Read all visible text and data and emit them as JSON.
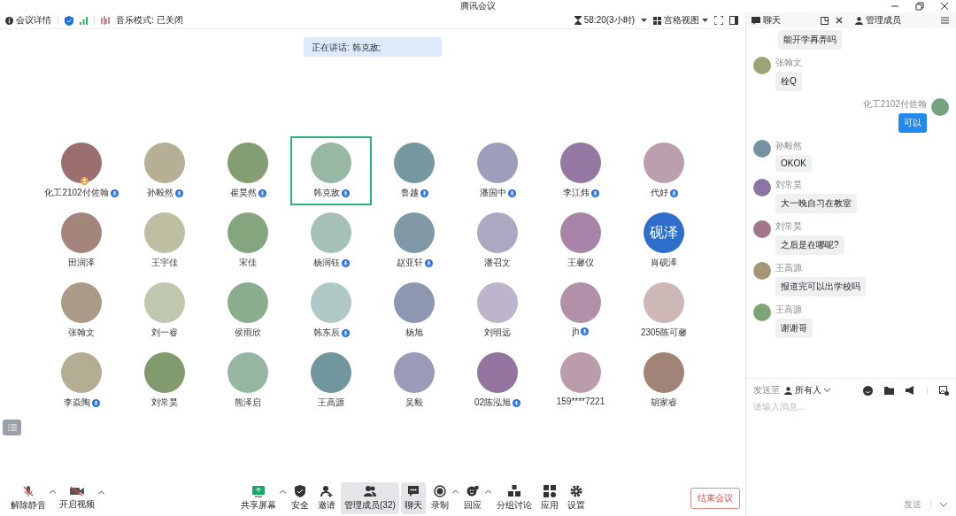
{
  "window": {
    "title": "腾讯会议"
  },
  "header": {
    "details": "会议详情",
    "music_mode": "音乐模式: 已关闭",
    "timer": "58:20(3小时)",
    "view": "宫格视图"
  },
  "speaking_banner": "正在讲话: 韩克敌;",
  "participants": [
    {
      "name": "化工2102付佐翰",
      "kind": "photo",
      "mic": true,
      "speaking": false,
      "host": true
    },
    {
      "name": "孙毅然",
      "kind": "photo",
      "mic": true,
      "speaking": false,
      "host": false
    },
    {
      "name": "崔昊然",
      "kind": "photo",
      "mic": true,
      "speaking": false,
      "host": false
    },
    {
      "name": "韩克敌",
      "kind": "photo",
      "mic": true,
      "speaking": true,
      "host": false
    },
    {
      "name": "鲁越",
      "kind": "photo",
      "mic": true,
      "speaking": false,
      "host": false
    },
    {
      "name": "潘国中",
      "kind": "photo",
      "mic": true,
      "speaking": false,
      "host": false
    },
    {
      "name": "李江炜",
      "kind": "photo",
      "mic": true,
      "speaking": false,
      "host": false
    },
    {
      "name": "代好",
      "kind": "photo",
      "mic": true,
      "speaking": false,
      "host": false
    },
    {
      "name": "田润泽",
      "kind": "photo",
      "mic": false,
      "speaking": false,
      "host": false
    },
    {
      "name": "王宇佳",
      "kind": "photo",
      "mic": false,
      "speaking": false,
      "host": false
    },
    {
      "name": "宋佳",
      "kind": "photo",
      "mic": false,
      "speaking": false,
      "host": false
    },
    {
      "name": "杨润钰",
      "kind": "photo",
      "mic": true,
      "speaking": false,
      "host": false
    },
    {
      "name": "赵亚轩",
      "kind": "photo",
      "mic": true,
      "speaking": false,
      "host": false
    },
    {
      "name": "潘召文",
      "kind": "photo",
      "mic": false,
      "speaking": false,
      "host": false
    },
    {
      "name": "王馨仪",
      "kind": "photo",
      "mic": false,
      "speaking": false,
      "host": false
    },
    {
      "name": "肖砚泽",
      "kind": "text",
      "initials": "砚泽",
      "mic": false,
      "speaking": false,
      "host": false
    },
    {
      "name": "张翰文",
      "kind": "photo",
      "mic": false,
      "speaking": false,
      "host": false
    },
    {
      "name": "刘一睿",
      "kind": "photo",
      "mic": false,
      "speaking": false,
      "host": false
    },
    {
      "name": "侯雨欣",
      "kind": "photo",
      "mic": false,
      "speaking": false,
      "host": false
    },
    {
      "name": "韩东辰",
      "kind": "photo",
      "mic": true,
      "speaking": false,
      "host": false
    },
    {
      "name": "杨旭",
      "kind": "photo",
      "mic": false,
      "speaking": false,
      "host": false
    },
    {
      "name": "刘明远",
      "kind": "photo",
      "mic": false,
      "speaking": false,
      "host": false
    },
    {
      "name": "jh",
      "kind": "photo",
      "mic": true,
      "speaking": false,
      "host": false
    },
    {
      "name": "2305陈可馨",
      "kind": "photo",
      "mic": false,
      "speaking": false,
      "host": false
    },
    {
      "name": "李焱陶",
      "kind": "photo",
      "mic": true,
      "speaking": false,
      "host": false
    },
    {
      "name": "刘常昊",
      "kind": "photo",
      "mic": false,
      "speaking": false,
      "host": false
    },
    {
      "name": "熊泽启",
      "kind": "photo",
      "mic": false,
      "speaking": false,
      "host": false
    },
    {
      "name": "王高源",
      "kind": "photo",
      "mic": false,
      "speaking": false,
      "host": false
    },
    {
      "name": "吴毅",
      "kind": "photo",
      "mic": false,
      "speaking": false,
      "host": false
    },
    {
      "name": "02陈泓旭",
      "kind": "photo",
      "mic": true,
      "speaking": false,
      "host": false
    },
    {
      "name": "159****7221",
      "kind": "photo",
      "mic": false,
      "speaking": false,
      "host": false
    },
    {
      "name": "胡家睿",
      "kind": "photo",
      "mic": false,
      "speaking": false,
      "host": false
    }
  ],
  "toolbar_left": [
    {
      "label": "解除静音",
      "caret": true
    },
    {
      "label": "开启视频",
      "caret": true
    }
  ],
  "toolbar": [
    {
      "label": "共享屏幕",
      "caret": true,
      "active": false
    },
    {
      "label": "安全",
      "caret": false,
      "active": false
    },
    {
      "label": "邀请",
      "caret": false,
      "active": false
    },
    {
      "label": "管理成员(32)",
      "caret": false,
      "active": true
    },
    {
      "label": "聊天",
      "caret": false,
      "active": true
    },
    {
      "label": "录制",
      "caret": true,
      "active": false
    },
    {
      "label": "回应",
      "caret": true,
      "active": false
    },
    {
      "label": "分组讨论",
      "caret": false,
      "active": false
    },
    {
      "label": "应用",
      "caret": false,
      "active": false
    },
    {
      "label": "设置",
      "caret": false,
      "active": false
    }
  ],
  "end_button": "结束会议",
  "chat": {
    "title": "聊天",
    "manage": "管理成员",
    "messages": [
      {
        "text": "能开学再弄吗",
        "self": false
      },
      {
        "sender": "张翰文",
        "text": "栓Q",
        "self": false
      },
      {
        "sender": "化工2102付佐翰",
        "text": "可以",
        "self": true
      },
      {
        "sender": "孙毅然",
        "text": "OKOK",
        "self": false
      },
      {
        "sender": "刘常昊",
        "text": "大一晚自习在教室",
        "self": false
      },
      {
        "sender": "刘常昊",
        "text": "之后是在哪呢?",
        "self": false
      },
      {
        "sender": "王高源",
        "text": "报道完可以出学校吗",
        "self": false
      },
      {
        "sender": "王高源",
        "text": "谢谢哥",
        "self": false
      }
    ],
    "send_to_label": "发送至",
    "recipient": "所有人",
    "placeholder": "请输入消息...",
    "send": "发送"
  }
}
